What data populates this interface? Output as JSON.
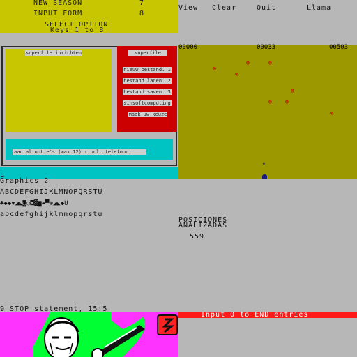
{
  "menu": {
    "items": [
      {
        "label": "NEW SEASON",
        "key": "7"
      },
      {
        "label": "INPUT FORM",
        "key": "8"
      }
    ],
    "select_option": "SELECT OPTION",
    "keys_hint": "Keys 1 to 8"
  },
  "commands": {
    "view": "View",
    "clear": "Clear",
    "quit": "Quit",
    "llama": "Llama"
  },
  "superfile": {
    "panel_title": "superfile inrichten",
    "header": "superfile",
    "options": [
      "nieuw bestand. 1",
      "bestand laden. 2",
      "bestand saven. 3",
      "sinsoftcomputing",
      "maak uw keuze"
    ],
    "status": "aantal optie's     (max.12)  (incl. telefoon)"
  },
  "game": {
    "scores": [
      "00000",
      "00033",
      "00503"
    ],
    "colors": {
      "field": "#9c9800",
      "mark": "#cc0000"
    }
  },
  "terminal": {
    "cursor_line": "L",
    "mode": "Graphics 2",
    "upper": "ABCDEFGHIJKLMNOPQRSTU",
    "graphics": "♣◆◆▼◢◣◙○◘▓▆▰▀⊛◢◣◆U",
    "lower": "abcdefghijklmnopqrstu"
  },
  "analysis": {
    "line1": "POSICIONES",
    "line2": "ANALIZADAS",
    "count": "559"
  },
  "stop_message": "9 STOP statement, 15:5",
  "input_prompt": "Input 0 to END entries"
}
